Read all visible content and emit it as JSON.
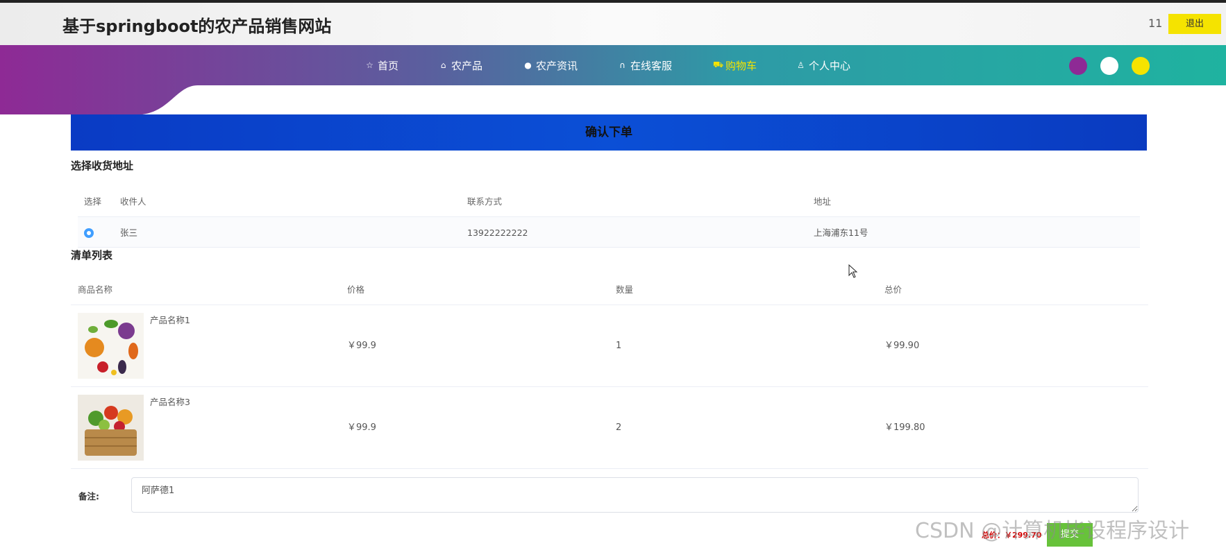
{
  "header": {
    "site_title": "基于springboot的农产品销售网站",
    "username": "11",
    "logout_label": "退出"
  },
  "nav": {
    "items": [
      {
        "label": "首页",
        "icon": "star-icon"
      },
      {
        "label": "农产品",
        "icon": "bag-icon"
      },
      {
        "label": "农产资讯",
        "icon": "info-icon"
      },
      {
        "label": "在线客服",
        "icon": "headset-icon"
      },
      {
        "label": "购物车",
        "icon": "cart-icon",
        "active": true
      },
      {
        "label": "个人中心",
        "icon": "user-icon"
      }
    ],
    "theme_dots": [
      "#8e2a95",
      "#ffffff",
      "#f5e300"
    ],
    "active_color": "#f5e300"
  },
  "banner": {
    "title": "确认下单"
  },
  "address_section": {
    "title": "选择收货地址",
    "headers": [
      "选择",
      "收件人",
      "联系方式",
      "地址"
    ],
    "rows": [
      {
        "selected": true,
        "name": "张三",
        "phone": "13922222222",
        "address": "上海浦东11号"
      }
    ]
  },
  "list_section": {
    "title": "清单列表",
    "headers": [
      "商品名称",
      "价格",
      "数量",
      "总价"
    ],
    "rows": [
      {
        "name": "产品名称1",
        "price": "￥99.9",
        "qty": "1",
        "total": "￥99.90"
      },
      {
        "name": "产品名称3",
        "price": "￥99.9",
        "qty": "2",
        "total": "￥199.80"
      }
    ]
  },
  "remark": {
    "label": "备注:",
    "value": "阿萨德1"
  },
  "footer": {
    "total_label": "总价：￥299.70",
    "submit_label": "提交"
  },
  "watermark": "CSDN @计算机毕设程序设计",
  "colors": {
    "banner": "#0b4fd6",
    "nav_start": "#8e2a95",
    "nav_end": "#1fb3a0",
    "submit": "#67c23a",
    "total": "#d40000"
  }
}
